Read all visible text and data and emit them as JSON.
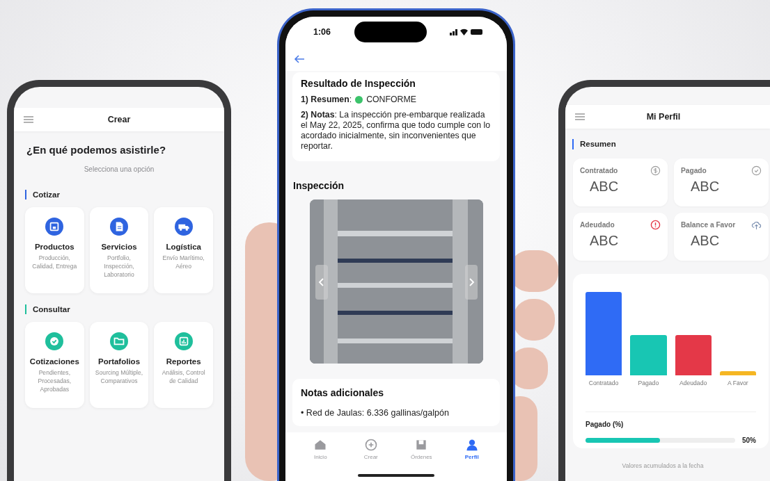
{
  "create_screen": {
    "title": "Crear",
    "heading": "¿En qué podemos asistirle?",
    "subtitle": "Selecciona una opción",
    "sections": [
      {
        "title": "Cotizar",
        "color": "#2f64e0",
        "cards": [
          {
            "title": "Productos",
            "description": "Producción, Calidad, Entrega"
          },
          {
            "title": "Servicios",
            "description": "Portfolio, Inspección, Laboratorio"
          },
          {
            "title": "Logística",
            "description": "Envío Marítimo, Aéreo"
          }
        ]
      },
      {
        "title": "Consultar",
        "color": "#1fbf9c",
        "cards": [
          {
            "title": "Cotizaciones",
            "description": "Pendientes, Procesadas, Aprobadas"
          },
          {
            "title": "Portafolios",
            "description": "Sourcing Múltiple, Comparativos"
          },
          {
            "title": "Reportes",
            "description": "Análisis, Control de Calidad"
          }
        ]
      }
    ]
  },
  "inspection_screen": {
    "time": "1:06",
    "result_title": "Resultado de Inspección",
    "summary_label": "**1) Resumen**:",
    "summary_status": {
      "color": "#3cc36b"
    },
    "summary_value": "CONFORME",
    "notes": "**2) Notas**: La inspección pre-embarque realizada el May 22, 2025, confirma que todo cumple con lo acordado inicialmente, sin inconvenientes que reportar.",
    "gallery_title": "Inspección",
    "additional_title": "Notas adicionales",
    "additional_items": [
      "• Red de Jaulas: 6.336 gallinas/galpón"
    ],
    "nav": [
      {
        "label": "Inicio",
        "selected": false
      },
      {
        "label": "Crear",
        "selected": false
      },
      {
        "label": "Órdenes",
        "selected": false
      },
      {
        "label": "Perfil",
        "selected": true
      }
    ]
  },
  "profile_screen": {
    "title": "Mi Perfil",
    "section_title": "Resumen",
    "summary_cards": [
      {
        "label": "Contratado",
        "value": "ABC"
      },
      {
        "label": "Pagado",
        "value": "ABC"
      },
      {
        "label": "Adeudado",
        "value": "ABC"
      },
      {
        "label": "Balance a Favor",
        "value": "ABC"
      }
    ],
    "bars": [
      {
        "label": "Contratado",
        "color": "#2f6bf5"
      },
      {
        "label": "Pagado",
        "color": "#18c6b3"
      },
      {
        "label": "Adeudado",
        "color": "#e43848"
      },
      {
        "label": "A Favor",
        "color": "#f5b623"
      }
    ],
    "paid": {
      "label": "Pagado (%)",
      "level": 0.5,
      "reading": "50%"
    },
    "footer": "Valores acumulados a la fecha"
  }
}
